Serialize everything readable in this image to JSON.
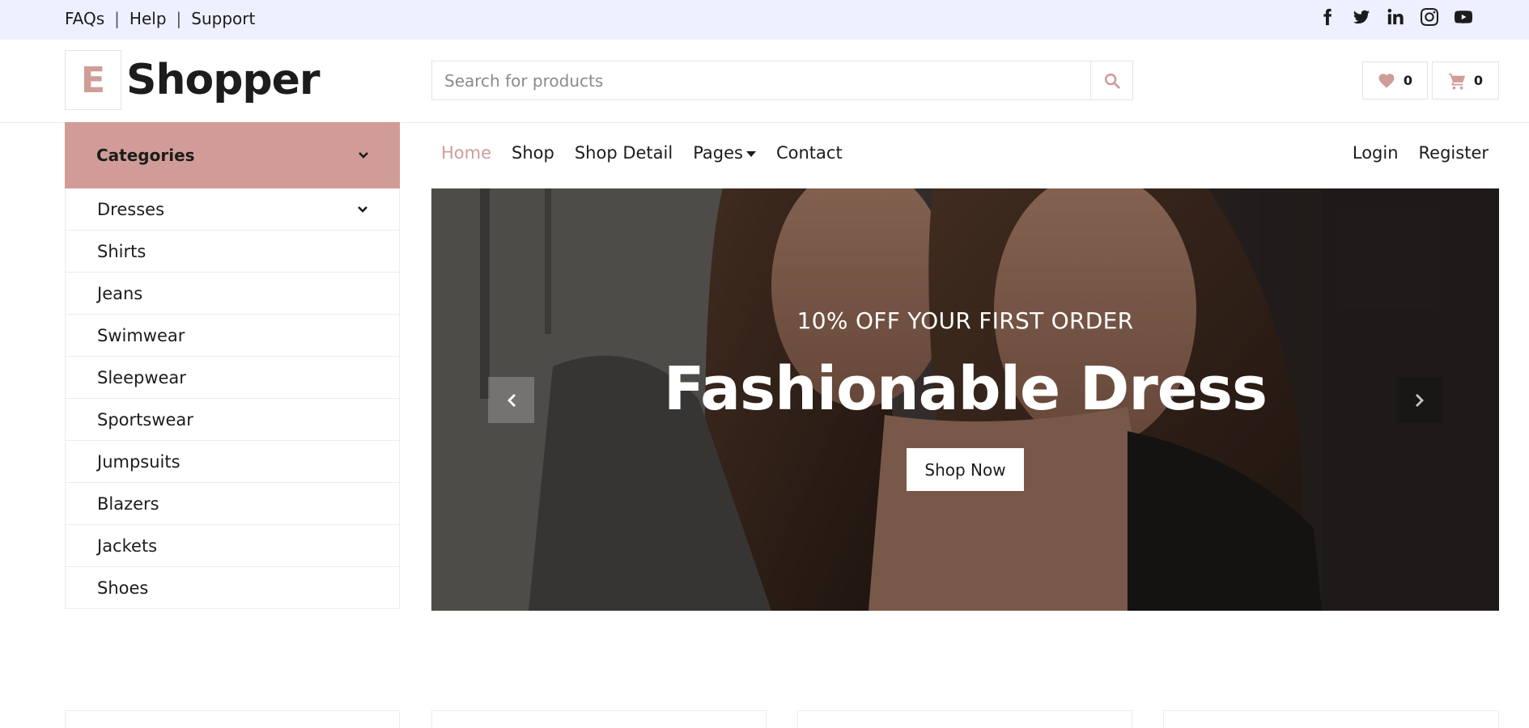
{
  "topbar": {
    "links": [
      "FAQs",
      "Help",
      "Support"
    ],
    "separator": "|",
    "social_icons": [
      "facebook-icon",
      "twitter-icon",
      "linkedin-icon",
      "instagram-icon",
      "youtube-icon"
    ]
  },
  "header": {
    "logo_letter": "E",
    "logo_text": "Shopper",
    "search_placeholder": "Search for products",
    "wishlist_count": "0",
    "cart_count": "0"
  },
  "categories": {
    "title": "Categories",
    "items": [
      {
        "label": "Dresses",
        "has_submenu": true
      },
      {
        "label": "Shirts"
      },
      {
        "label": "Jeans"
      },
      {
        "label": "Swimwear"
      },
      {
        "label": "Sleepwear"
      },
      {
        "label": "Sportswear"
      },
      {
        "label": "Jumpsuits"
      },
      {
        "label": "Blazers"
      },
      {
        "label": "Jackets"
      },
      {
        "label": "Shoes"
      }
    ]
  },
  "nav": {
    "items": [
      "Home",
      "Shop",
      "Shop Detail",
      "Pages",
      "Contact"
    ],
    "active": "Home",
    "right": [
      "Login",
      "Register"
    ]
  },
  "hero": {
    "subtitle": "10% OFF YOUR FIRST ORDER",
    "title": "Fashionable Dress",
    "button": "Shop Now"
  },
  "colors": {
    "accent": "#d19c97",
    "topbar_bg": "#edf1ff",
    "text": "#1c1c1c"
  }
}
